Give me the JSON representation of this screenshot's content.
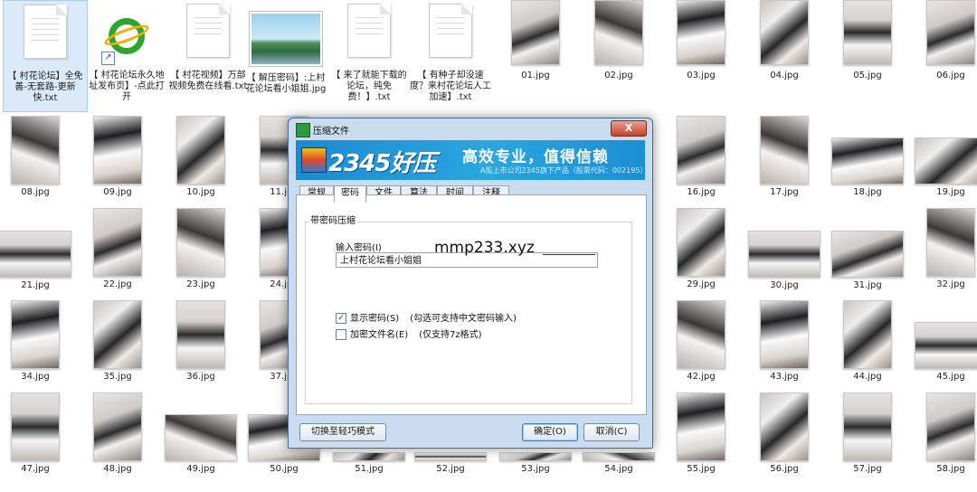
{
  "files_row1": [
    {
      "label": "【 村花论坛】全免善-无套路-更新快.txt",
      "icon": "text-file-icon",
      "selected": true
    },
    {
      "label": "【 村花论坛永久地址发布页】-点此打开",
      "icon": "ie-shortcut-icon"
    },
    {
      "label": "【 村花视频】万部视频免费在线看.txt",
      "icon": "text-file-icon"
    },
    {
      "label": "【 解压密码】:上村花论坛看小姐姐.jpg",
      "icon": "image-icon"
    },
    {
      "label": "【 来了就能下载的论坛，纯免费！】.txt",
      "icon": "text-file-icon"
    },
    {
      "label": "【 有种子却没速度？来村花论坛人工加速】.txt",
      "icon": "text-file-icon"
    }
  ],
  "photos": {
    "row1": [
      "01.jpg",
      "02.jpg",
      "03.jpg",
      "04.jpg",
      "05.jpg",
      "06.jpg"
    ],
    "row2_left": [
      "08.jpg",
      "09.jpg",
      "10.jpg",
      "11.jpg"
    ],
    "row2_right": [
      "16.jpg",
      "17.jpg",
      "18.jpg",
      "19.jpg"
    ],
    "row3_left": [
      "21.jpg",
      "22.jpg",
      "23.jpg",
      "24.jpg"
    ],
    "row3_right": [
      "29.jpg",
      "30.jpg",
      "31.jpg",
      "32.jpg"
    ],
    "row4_left": [
      "34.jpg",
      "35.jpg",
      "36.jpg",
      "37.jpg"
    ],
    "row4_right": [
      "42.jpg",
      "43.jpg",
      "44.jpg",
      "45.jpg"
    ],
    "row5": [
      "47.jpg",
      "48.jpg",
      "49.jpg",
      "50.jpg",
      "51.jpg",
      "52.jpg",
      "53.jpg",
      "54.jpg",
      "55.jpg",
      "56.jpg",
      "57.jpg",
      "58.jpg"
    ]
  },
  "dialog": {
    "title": "压缩文件",
    "close_label": "X",
    "brand": "2345好压",
    "slogan": "高效专业，值得信赖",
    "subline": "A股上市公司2345旗下产品（股票代码：002195）",
    "tabs": [
      "常规",
      "密码",
      "文件",
      "算法",
      "时间",
      "注释"
    ],
    "active_tab": "密码",
    "group_title": "带密码压缩",
    "password_label": "输入密码(I)",
    "password_value": "上村花论坛看小姐姐",
    "show_password": {
      "label": "显示密码(S)",
      "checked": true,
      "hint": "(勾选可支持中文密码输入)"
    },
    "encrypt_names": {
      "label": "加密文件名(E)",
      "checked": false,
      "hint": "(仅支持7z格式)"
    },
    "switch_button": "切换至轻巧模式",
    "ok_button": "确定(O)",
    "cancel_button": "取消(C)"
  },
  "watermark": "mmp233.xyz"
}
